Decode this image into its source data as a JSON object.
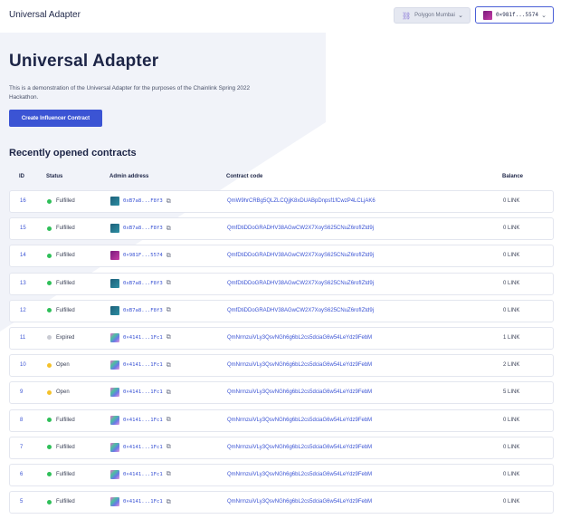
{
  "app": {
    "title": "Universal Adapter",
    "network_label": "Polygon Mumbai",
    "account_label": "0×981f...5574"
  },
  "hero": {
    "heading": "Universal Adapter",
    "description": "This is a demonstration of the Universal Adapter for the purposes of the Chainlink Spring 2022 Hackathon.",
    "create_button": "Create Influencer Contract"
  },
  "contracts": {
    "title": "Recently opened contracts",
    "columns": [
      "ID",
      "Status",
      "Admin address",
      "Contract code",
      "Balance"
    ],
    "rows": [
      {
        "id": "16",
        "status": "Fulfilled",
        "status_color": "#2fbf59",
        "admin": "0xB7a8...F8f3",
        "avatar": "teal",
        "code": "QmW9hrCRBg5QLZLCQjjK8xDUABpDnpsf1fCwzP4LCLjAK6",
        "balance": "0 LINK"
      },
      {
        "id": "15",
        "status": "Fulfilled",
        "status_color": "#2fbf59",
        "admin": "0xB7a8...F8f3",
        "avatar": "teal",
        "code": "QmfDtiDDoGRADHV38AGwCW2X7XoyS625CNuZ6rofIZtd9j",
        "balance": "0 LINK"
      },
      {
        "id": "14",
        "status": "Fulfilled",
        "status_color": "#2fbf59",
        "admin": "0×981F...5574",
        "avatar": "pink",
        "code": "QmfDtiDDoGRADHV38AGwCW2X7XoyS625CNuZ6rofIZtd9j",
        "balance": "0 LINK"
      },
      {
        "id": "13",
        "status": "Fulfilled",
        "status_color": "#2fbf59",
        "admin": "0xB7a8...F8f3",
        "avatar": "teal",
        "code": "QmfDtiDDoGRADHV38AGwCW2X7XoyS625CNuZ6rofIZtd9j",
        "balance": "0 LINK"
      },
      {
        "id": "12",
        "status": "Fulfilled",
        "status_color": "#2fbf59",
        "admin": "0xB7a8...F8f3",
        "avatar": "teal",
        "code": "QmfDtiDDoGRADHV38AGwCW2X7XoyS625CNuZ6rofIZtd9j",
        "balance": "0 LINK"
      },
      {
        "id": "11",
        "status": "Expired",
        "status_color": "#c9cbd3",
        "admin": "0×4141...1Fc1",
        "avatar": "multi",
        "code": "QmNrmzuiVLy3QsvNGh6g6bL2cs5dciaG6w54LeYdz9FebM",
        "balance": "1 LINK"
      },
      {
        "id": "10",
        "status": "Open",
        "status_color": "#f4c12b",
        "admin": "0×4141...1Fc1",
        "avatar": "multi",
        "code": "QmNrmzuiVLy3QsvNGh6g6bL2cs5dciaG6w54LeYdz9FebM",
        "balance": "2 LINK"
      },
      {
        "id": "9",
        "status": "Open",
        "status_color": "#f4c12b",
        "admin": "0×4141...1Fc1",
        "avatar": "multi",
        "code": "QmNrmzuiVLy3QsvNGh6g6bL2cs5dciaG6w54LeYdz9FebM",
        "balance": "5 LINK"
      },
      {
        "id": "8",
        "status": "Fulfilled",
        "status_color": "#2fbf59",
        "admin": "0×4141...1Fc1",
        "avatar": "multi",
        "code": "QmNrmzuiVLy3QsvNGh6g6bL2cs5dciaG6w54LeYdz9FebM",
        "balance": "0 LINK"
      },
      {
        "id": "7",
        "status": "Fulfilled",
        "status_color": "#2fbf59",
        "admin": "0×4141...1Fc1",
        "avatar": "multi",
        "code": "QmNrmzuiVLy3QsvNGh6g6bL2cs5dciaG6w54LeYdz9FebM",
        "balance": "0 LINK"
      },
      {
        "id": "6",
        "status": "Fulfilled",
        "status_color": "#2fbf59",
        "admin": "0×4141...1Fc1",
        "avatar": "multi",
        "code": "QmNrmzuiVLy3QsvNGh6g6bL2cs5dciaG6w54LeYdz9FebM",
        "balance": "0 LINK"
      },
      {
        "id": "5",
        "status": "Fulfilled",
        "status_color": "#2fbf59",
        "admin": "0×4141...1Fc1",
        "avatar": "multi",
        "code": "QmNrmzuiVLy3QsvNGh6g6bL2cs5dciaG6w54LeYdz9FebM",
        "balance": "0 LINK"
      }
    ]
  },
  "icons": {
    "network": "link-chain-icon",
    "dropdown": "chevron-down-icon",
    "copy": "copy-icon"
  },
  "colors": {
    "primary": "#3b54d4",
    "text": "#1d2547"
  }
}
